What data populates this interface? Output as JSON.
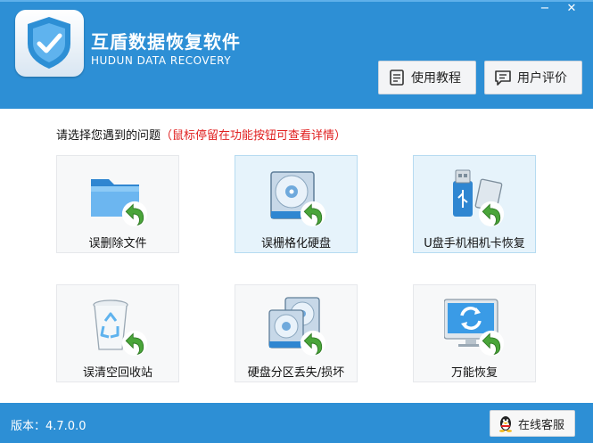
{
  "header": {
    "title": "互盾数据恢复软件",
    "subtitle": "HUDUN DATA RECOVERY",
    "minimize_glyph": "−",
    "close_glyph": "✕",
    "tutorial_label": "使用教程",
    "review_label": "用户评价"
  },
  "main": {
    "prompt": "请选择您遇到的问题",
    "hint": "（鼠标停留在功能按钮可查看详情）",
    "cards": [
      {
        "label": "误删除文件",
        "icon": "folder-restore-icon"
      },
      {
        "label": "误栅格化硬盘",
        "icon": "disk-restore-icon"
      },
      {
        "label": "U盘手机相机卡恢复",
        "icon": "usb-card-restore-icon"
      },
      {
        "label": "误清空回收站",
        "icon": "recycle-bin-restore-icon"
      },
      {
        "label": "硬盘分区丢失/损坏",
        "icon": "partition-restore-icon"
      },
      {
        "label": "万能恢复",
        "icon": "monitor-restore-icon"
      }
    ]
  },
  "footer": {
    "version": "版本：4.7.0.0",
    "service_label": "在线客服"
  },
  "colors": {
    "brand_blue": "#2d8fd5",
    "hint_red": "#e02020",
    "arrow_green": "#4aa53a",
    "card_highlight": "#e6f3fb"
  }
}
